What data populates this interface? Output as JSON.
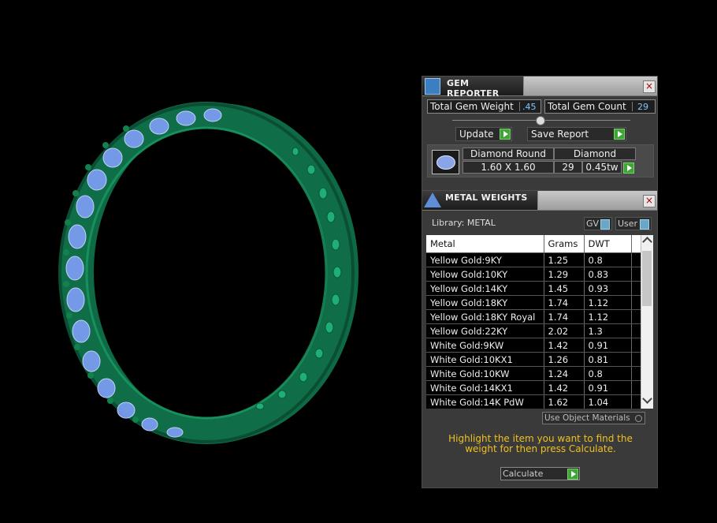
{
  "gem_reporter": {
    "title": "GEM REPORTER",
    "total_gem_weight_label": "Total Gem Weight",
    "total_gem_weight_value": ".45",
    "total_gem_count_label": "Total Gem Count",
    "total_gem_count_value": "29",
    "update_label": "Update",
    "save_report_label": "Save Report",
    "gem": {
      "shape": "Diamond Round",
      "type": "Diamond",
      "size": "1.60 X 1.60",
      "count": "29",
      "weight": "0.45tw"
    }
  },
  "metal_weights": {
    "title": "METAL WEIGHTS",
    "library_label": "Library: METAL",
    "gv_label": "GV",
    "user_label": "User",
    "columns": [
      "Metal",
      "Grams",
      "DWT"
    ],
    "rows": [
      [
        "Yellow Gold:9KY",
        "1.25",
        "0.8"
      ],
      [
        "Yellow Gold:10KY",
        "1.29",
        "0.83"
      ],
      [
        "Yellow Gold:14KY",
        "1.45",
        "0.93"
      ],
      [
        "Yellow Gold:18KY",
        "1.74",
        "1.12"
      ],
      [
        "Yellow Gold:18KY Royal",
        "1.74",
        "1.12"
      ],
      [
        "Yellow Gold:22KY",
        "2.02",
        "1.3"
      ],
      [
        "White Gold:9KW",
        "1.42",
        "0.91"
      ],
      [
        "White Gold:10KX1",
        "1.26",
        "0.81"
      ],
      [
        "White Gold:10KW",
        "1.24",
        "0.8"
      ],
      [
        "White Gold:14KX1",
        "1.42",
        "0.91"
      ],
      [
        "White Gold:14K PdW",
        "1.62",
        "1.04"
      ]
    ],
    "use_object_materials_label": "Use Object Materials",
    "hint": "Highlight the item you want to find the weight for then press Calculate.",
    "calculate_label": "Calculate"
  },
  "colors": {
    "ring_green": "#0f6e48",
    "gem_blue": "#7a9cf0",
    "hint_yellow": "#f0c020",
    "value_blue": "#7ec8ff",
    "play_green": "#3fa535"
  }
}
